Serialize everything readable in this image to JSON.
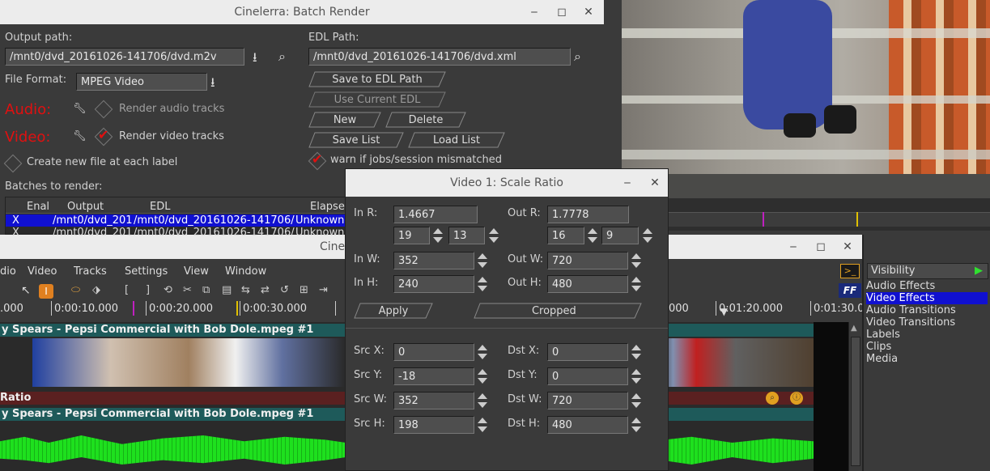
{
  "batch": {
    "title": "Cinelerra: Batch Render",
    "output_path_label": "Output path:",
    "output_path": "/mnt0/dvd_20161026-141706/dvd.m2v",
    "file_format_label": "File Format:",
    "file_format": "MPEG Video",
    "audio_label": "Audio:",
    "video_label": "Video:",
    "render_audio": "Render audio tracks",
    "render_video": "Render video tracks",
    "create_new_file": "Create new file at each label",
    "batches_label": "Batches to render:",
    "edl_path_label": "EDL Path:",
    "edl_path": "/mnt0/dvd_20161026-141706/dvd.xml",
    "save_edl": "Save to EDL Path",
    "use_current_edl": "Use Current EDL",
    "new": "New",
    "delete": "Delete",
    "save_list": "Save List",
    "load_list": "Load List",
    "warn": "warn if jobs/session mismatched",
    "columns": [
      "Enal",
      "Output",
      "EDL",
      "Elapse"
    ],
    "rows": [
      {
        "enabled": "X",
        "output": "/mnt0/dvd_201",
        "edl": "/mnt0/dvd_20161026-141706/",
        "elapsed": "Unknown"
      },
      {
        "enabled": "X",
        "output": "/mnt0/dvd_201",
        "edl": "/mnt0/dvd_20161026-141706/",
        "elapsed": "Unknown"
      }
    ]
  },
  "scale": {
    "title": "Video 1: Scale Ratio",
    "in_r_label": "In R:",
    "in_r": "1.4667",
    "in_r_a": "19",
    "in_r_b": "13",
    "out_r_label": "Out R:",
    "out_r": "1.7778",
    "out_r_a": "16",
    "out_r_b": "9",
    "in_w_label": "In W:",
    "in_w": "352",
    "out_w_label": "Out W:",
    "out_w": "720",
    "in_h_label": "In H:",
    "in_h": "240",
    "out_h_label": "Out H:",
    "out_h": "480",
    "apply": "Apply",
    "mode": "Cropped",
    "src_x_label": "Src X:",
    "src_x": "0",
    "dst_x_label": "Dst X:",
    "dst_x": "0",
    "src_y_label": "Src Y:",
    "src_y": "-18",
    "dst_y_label": "Dst Y:",
    "dst_y": "0",
    "src_w_label": "Src W:",
    "src_w": "352",
    "dst_w_label": "Dst W:",
    "dst_w": "720",
    "src_h_label": "Src H:",
    "src_h": "198",
    "dst_h_label": "Dst H:",
    "dst_h": "480"
  },
  "main": {
    "title": "Cine",
    "menu": [
      "dio",
      "Video",
      "Tracks",
      "Settings",
      "View",
      "Window"
    ],
    "ruler": [
      ".000",
      "0:00:10.000",
      "0:00:20.000",
      "0:00:30.000",
      "000",
      "0:01:20.000",
      "0:01:30.0"
    ],
    "track1": "y Spears - Pepsi Commercial with Bob Dole.mpeg #1",
    "effect": "Ratio",
    "track2": "y Spears - Pepsi Commercial with Bob Dole.mpeg #1"
  },
  "resources": {
    "visibility": "Visibility",
    "items": [
      "Audio Effects",
      "Video Effects",
      "Audio Transitions",
      "Video Transitions",
      "Labels",
      "Clips",
      "Media"
    ],
    "selected": "Video Effects"
  },
  "colors": {
    "accent_red": "#e01010",
    "selection_blue": "#1010d0",
    "audio_green": "#1ee01e",
    "track_title_teal": "#1e5a5a"
  }
}
